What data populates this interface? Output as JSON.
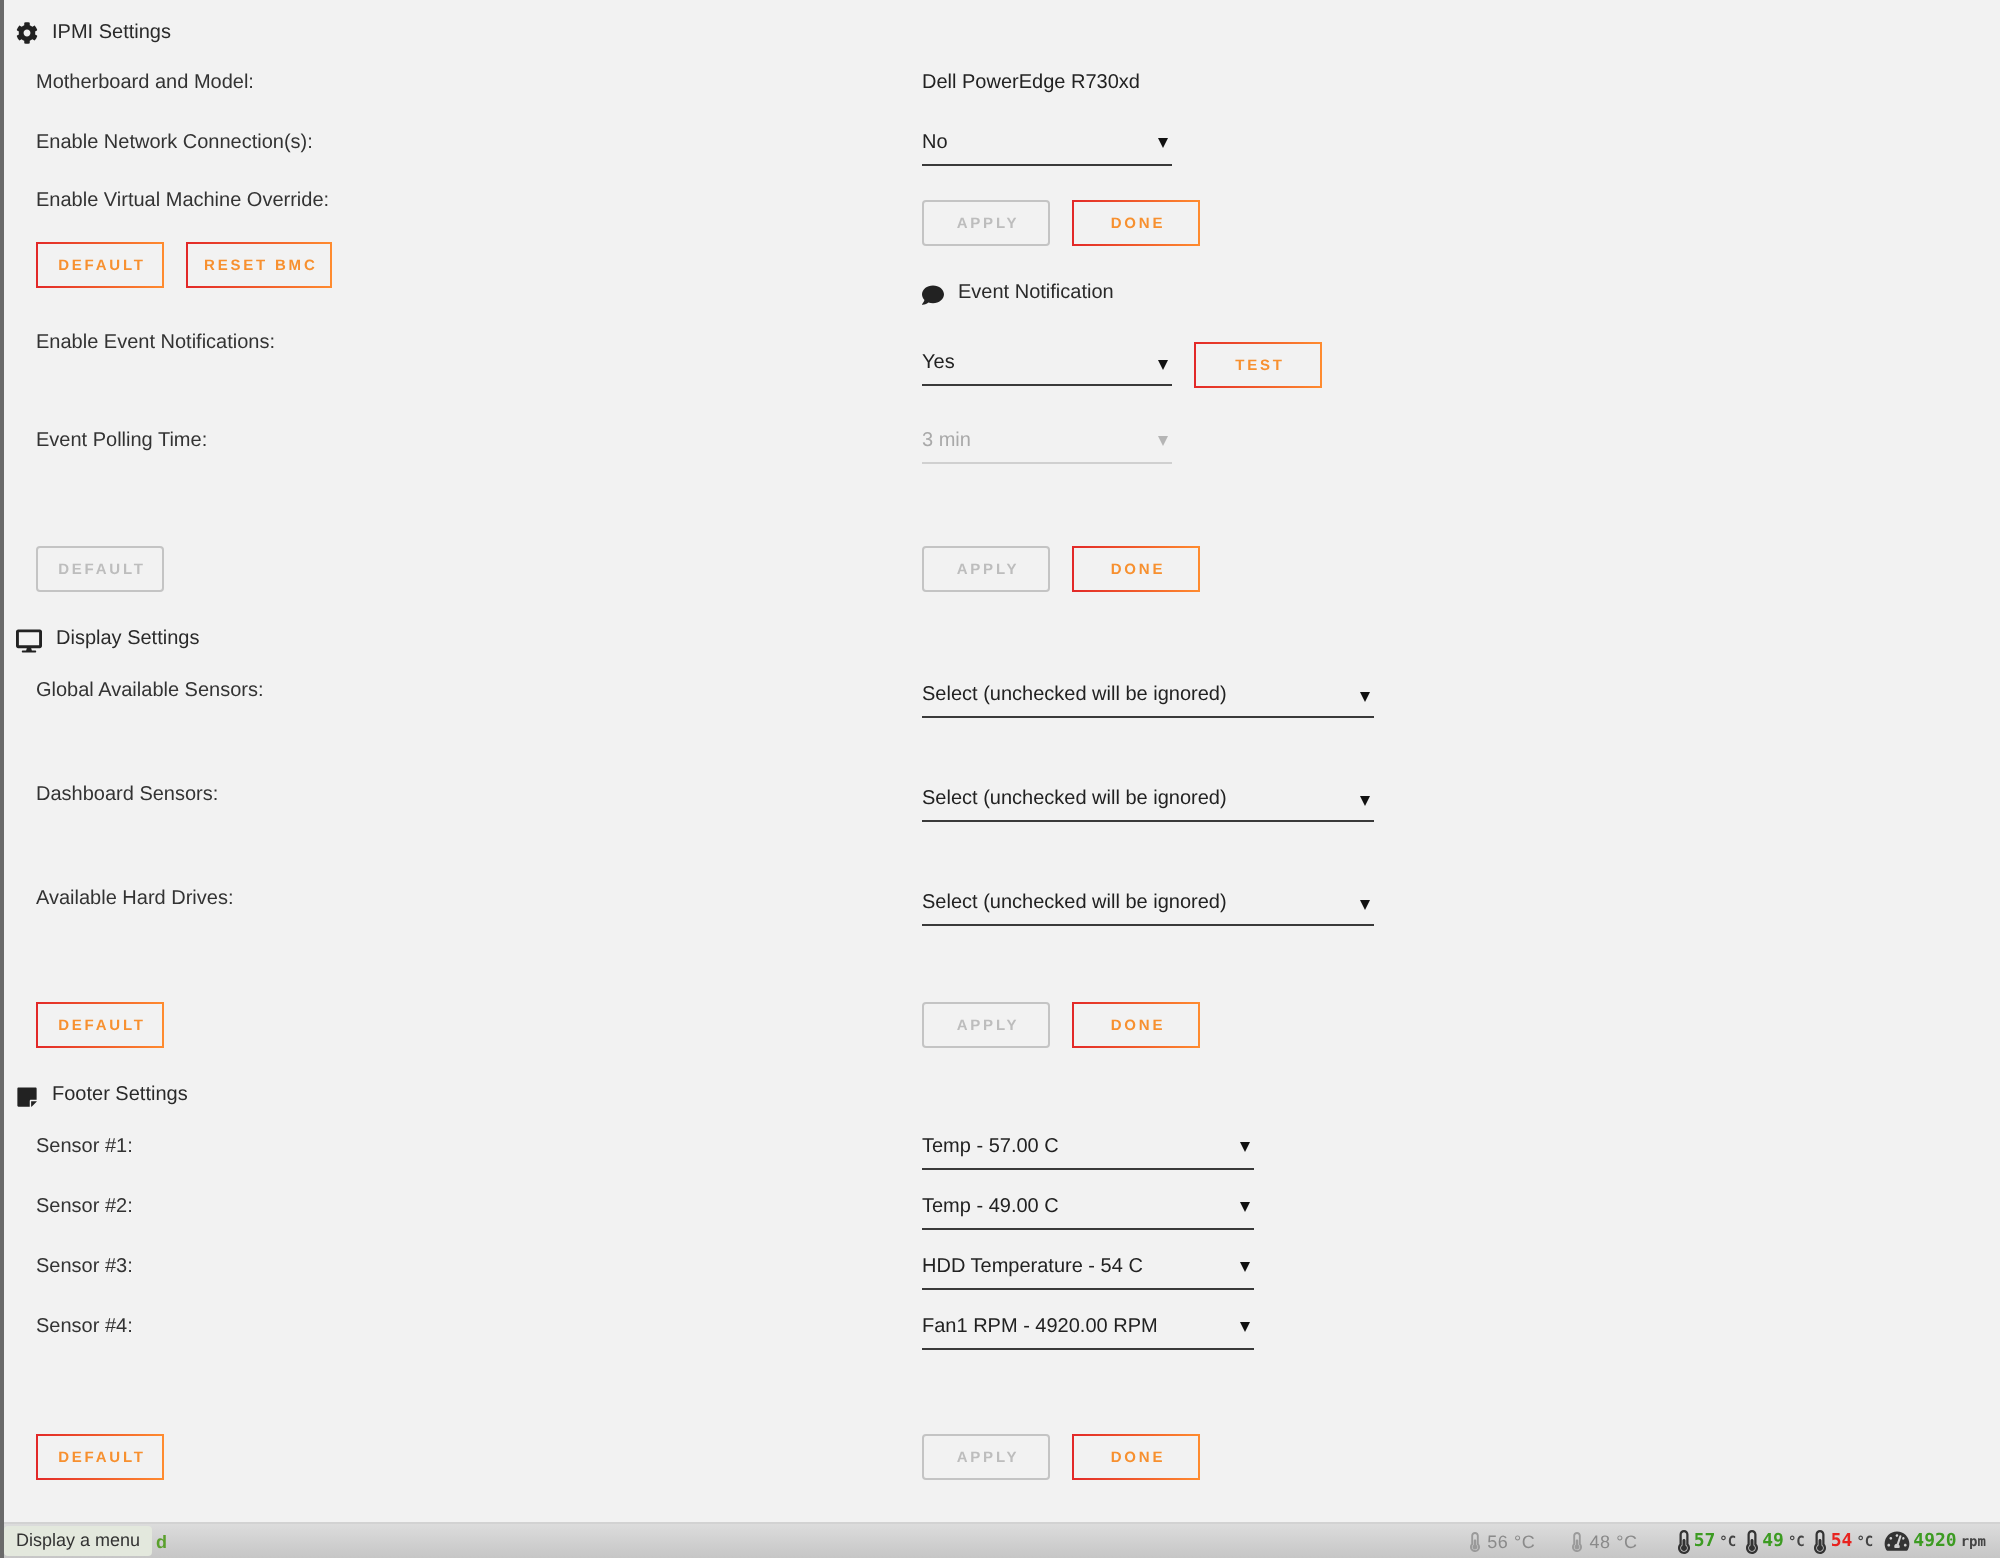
{
  "ipmi_settings": {
    "title": "IPMI Settings",
    "motherboard": {
      "label": "Motherboard and Model:",
      "value": "Dell PowerEdge R730xd"
    },
    "network": {
      "label": "Enable Network Connection(s):",
      "value": "No",
      "disabled": false
    },
    "vm_override": {
      "label": "Enable Virtual Machine Override:"
    },
    "buttons": [
      {
        "label": "DEFAULT",
        "disabled": false
      },
      {
        "label": "RESET BMC",
        "disabled": false
      }
    ],
    "actions": [
      {
        "label": "APPLY",
        "disabled": true
      },
      {
        "label": "DONE",
        "disabled": false
      }
    ]
  },
  "event_notification": {
    "title": "Event Notification",
    "notifications": {
      "label": "Enable Event Notifications:",
      "value": "Yes",
      "disabled": false
    },
    "test_button": {
      "label": "TEST",
      "disabled": false
    },
    "polling": {
      "label": "Event Polling Time:",
      "value": "3 min",
      "disabled": true
    },
    "buttons": [
      {
        "label": "DEFAULT",
        "disabled": true
      }
    ],
    "actions": [
      {
        "label": "APPLY",
        "disabled": true
      },
      {
        "label": "DONE",
        "disabled": false
      }
    ]
  },
  "display_settings": {
    "title": "Display Settings",
    "rows": [
      {
        "label": "Global Available Sensors:",
        "value": "Select (unchecked will be ignored)",
        "disabled": false
      },
      {
        "label": "Dashboard Sensors:",
        "value": "Select (unchecked will be ignored)",
        "disabled": false
      },
      {
        "label": "Available Hard Drives:",
        "value": "Select (unchecked will be ignored)",
        "disabled": false
      }
    ],
    "buttons": [
      {
        "label": "DEFAULT",
        "disabled": false
      }
    ],
    "actions": [
      {
        "label": "APPLY",
        "disabled": true
      },
      {
        "label": "DONE",
        "disabled": false
      }
    ]
  },
  "footer_settings": {
    "title": "Footer Settings",
    "rows": [
      {
        "label": "Sensor #1:",
        "value": "Temp - 57.00 C",
        "disabled": false
      },
      {
        "label": "Sensor #2:",
        "value": "Temp - 49.00 C",
        "disabled": false
      },
      {
        "label": "Sensor #3:",
        "value": "HDD Temperature - 54 C",
        "disabled": false
      },
      {
        "label": "Sensor #4:",
        "value": "Fan1 RPM - 4920.00 RPM",
        "disabled": false
      }
    ],
    "buttons": [
      {
        "label": "DEFAULT",
        "disabled": false
      }
    ],
    "actions": [
      {
        "label": "APPLY",
        "disabled": true
      },
      {
        "label": "DONE",
        "disabled": false
      }
    ]
  },
  "status_bar": {
    "tooltip": "Display a menu",
    "indicator": "d",
    "system_temps": [
      {
        "reading": "56 °C"
      },
      {
        "reading": "48 °C"
      }
    ],
    "footer_sensors": [
      {
        "kind": "temp",
        "value": "57",
        "unit": "°C",
        "color": "#3c9b22"
      },
      {
        "kind": "temp",
        "value": "49",
        "unit": "°C",
        "color": "#3c9b22"
      },
      {
        "kind": "temp",
        "value": "54",
        "unit": "°C",
        "color": "#e8231f"
      },
      {
        "kind": "fan",
        "value": "4920",
        "unit": "rpm",
        "color": "#3c9b22"
      }
    ]
  }
}
